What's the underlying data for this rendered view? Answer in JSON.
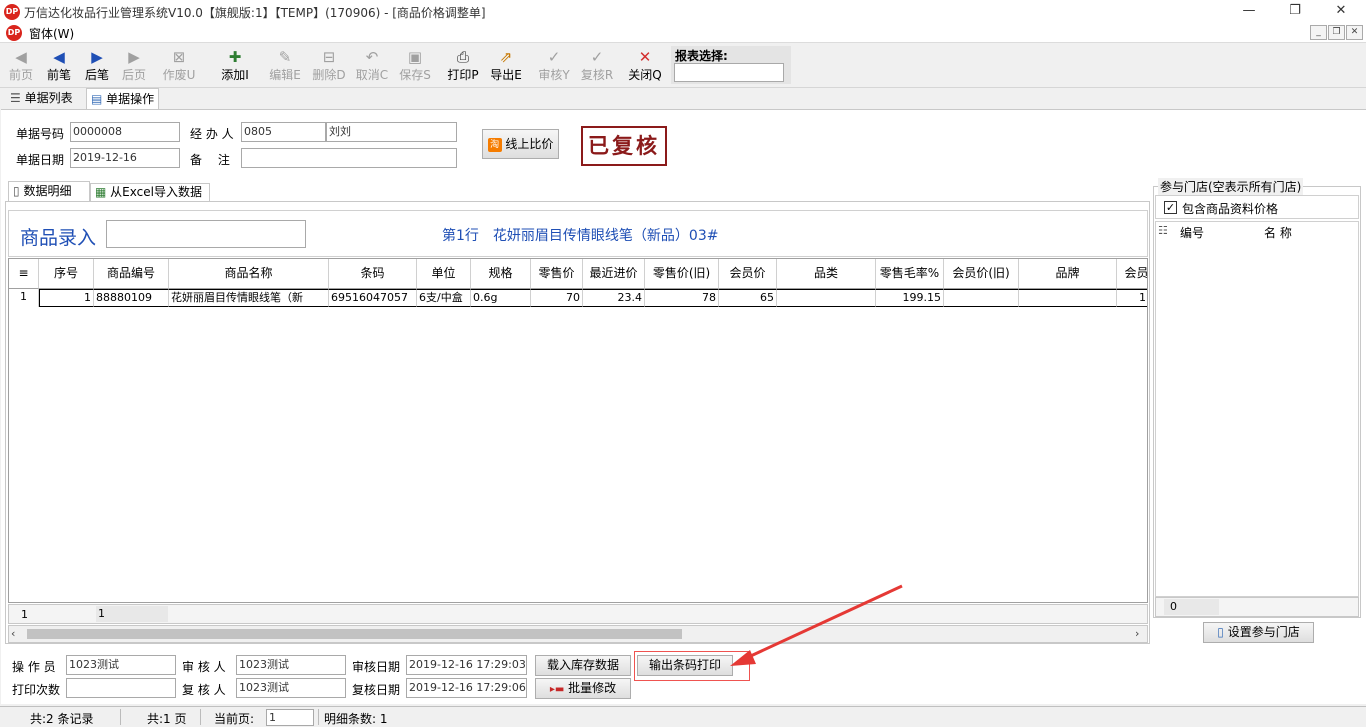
{
  "window": {
    "title": "万信达化妆品行业管理系统V10.0【旗舰版:1】【TEMP】(170906) - [商品价格调整单]",
    "logo_text": "DP",
    "menu": "窗体(W)"
  },
  "toolbar": {
    "items": [
      {
        "label": "前页",
        "icon": "◀",
        "enabled": false
      },
      {
        "label": "前笔",
        "icon": "◀",
        "enabled": true
      },
      {
        "label": "后笔",
        "icon": "▶",
        "enabled": true
      },
      {
        "label": "后页",
        "icon": "▶",
        "enabled": false
      },
      {
        "label": "作废U",
        "icon": "⊠",
        "enabled": false
      },
      {
        "label": "添加I",
        "icon": "✚",
        "enabled": true
      },
      {
        "label": "编辑E",
        "icon": "✎",
        "enabled": false
      },
      {
        "label": "删除D",
        "icon": "⊟",
        "enabled": false
      },
      {
        "label": "取消C",
        "icon": "↶",
        "enabled": false
      },
      {
        "label": "保存S",
        "icon": "▣",
        "enabled": false
      },
      {
        "label": "打印P",
        "icon": "⎙",
        "enabled": true
      },
      {
        "label": "导出E",
        "icon": "⇗",
        "enabled": true
      },
      {
        "label": "审核Y",
        "icon": "✓",
        "enabled": false
      },
      {
        "label": "复核R",
        "icon": "✓",
        "enabled": false
      },
      {
        "label": "关闭Q",
        "icon": "✕",
        "enabled": true
      }
    ],
    "report_label": "报表选择:",
    "report_value": ""
  },
  "tabs": {
    "list": "单据列表",
    "operate": "单据操作"
  },
  "header": {
    "doc_no_label": "单据号码",
    "doc_no": "0000008",
    "agent_label": "经 办 人",
    "agent_code": "0805",
    "agent_name": "刘刘",
    "date_label": "单据日期",
    "date": "2019-12-16",
    "note_label": "备　 注",
    "note": "",
    "compare_button": "线上比价",
    "status_stamp": "已复核"
  },
  "subtabs": {
    "detail": "数据明细",
    "excel": "从Excel导入数据"
  },
  "entry": {
    "label": "商品录入",
    "value": "",
    "row_info": "第1行　花妍丽眉目传情眼线笔（新品）03#"
  },
  "grid": {
    "columns": [
      "序号",
      "商品编号",
      "商品名称",
      "条码",
      "单位",
      "规格",
      "零售价",
      "最近进价",
      "零售价(旧)",
      "会员价",
      "品类",
      "零售毛率%",
      "会员价(旧)",
      "品牌",
      "会员"
    ],
    "rows": [
      {
        "rownum": "1",
        "seq": "1",
        "code": "88880109",
        "name": "花妍丽眉目传情眼线笔（新",
        "barcode": "69516047057",
        "unit": "6支/中盒",
        "spec": "0.6g",
        "retail": "70",
        "last_cost": "23.4",
        "retail_old": "78",
        "member": "65",
        "category": "",
        "margin": "199.15",
        "member_old": "",
        "brand": "",
        "extra": "1"
      }
    ],
    "footer_index": "1",
    "footer_count": "1"
  },
  "stores": {
    "title": "参与门店(空表示所有门店)",
    "include_label": "包含商品资料价格",
    "include_checked": true,
    "col_code": "编号",
    "col_name": "名 称",
    "count": "0",
    "set_button": "设置参与门店"
  },
  "bottom": {
    "operator_label": "操 作 员",
    "operator": "1023测试",
    "auditor_label": "审 核 人",
    "auditor": "1023测试",
    "audit_date_label": "审核日期",
    "audit_date": "2019-12-16 17:29:03",
    "print_count_label": "打印次数",
    "print_count": "",
    "reviewer_label": "复 核 人",
    "reviewer": "1023测试",
    "review_date_label": "复核日期",
    "review_date": "2019-12-16 17:29:06",
    "load_stock_button": "载入库存数据",
    "barcode_print_button": "输出条码打印",
    "batch_edit_button": "批量修改"
  },
  "statusbar": {
    "records": "共:2 条记录",
    "pages": "共:1 页",
    "current_label": "当前页:",
    "current_page": "1",
    "detail_count": "明细条数: 1"
  },
  "colors": {
    "accent": "#1f4fb5",
    "stamp": "#8b1a1a",
    "annotation": "#e53935"
  }
}
